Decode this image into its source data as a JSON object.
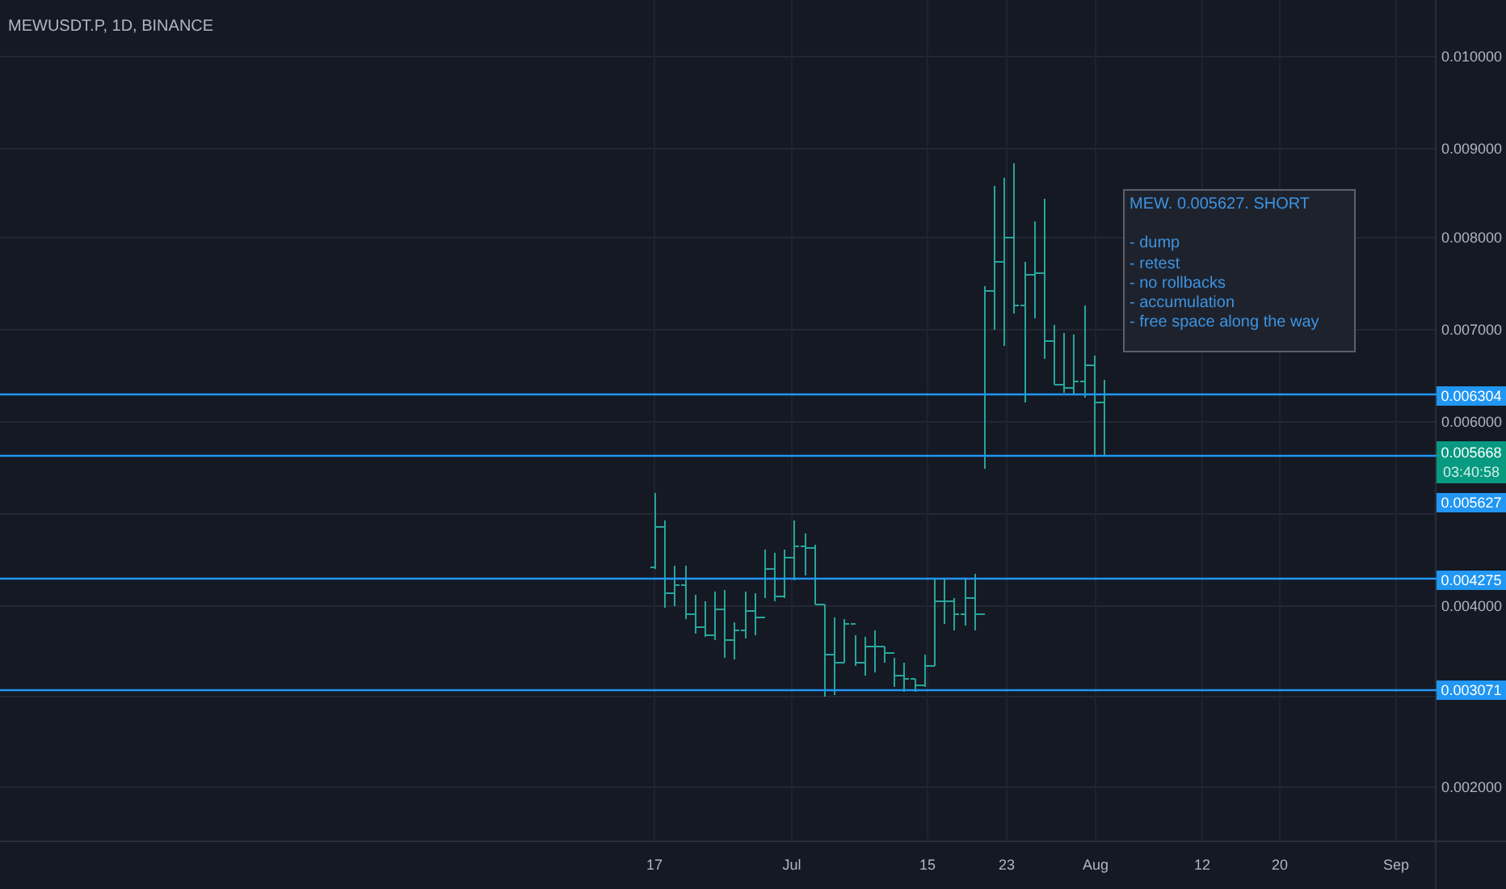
{
  "chart": {
    "title": "MEWUSDT.P, 1D, BINANCE",
    "price_axis": [
      "0.010000",
      "0.009000",
      "0.008000",
      "0.007000",
      "0.006000",
      "0.004000",
      "0.002000"
    ],
    "time_axis": [
      "17",
      "Jul",
      "15",
      "23",
      "Aug",
      "12",
      "20",
      "Sep"
    ],
    "levels": [
      {
        "price_tag": "0.006304"
      },
      {
        "price_tag": "0.005627"
      },
      {
        "price_tag": "0.004275"
      },
      {
        "price_tag": "0.003071"
      }
    ],
    "last_price": {
      "price": "0.005668",
      "countdown": "03:40:58"
    },
    "note": {
      "title": "MEW. 0.005627. SHORT",
      "lines": [
        "- dump",
        "- retest",
        "- no rollbacks",
        "- accumulation",
        "- free space along the way"
      ]
    }
  }
}
